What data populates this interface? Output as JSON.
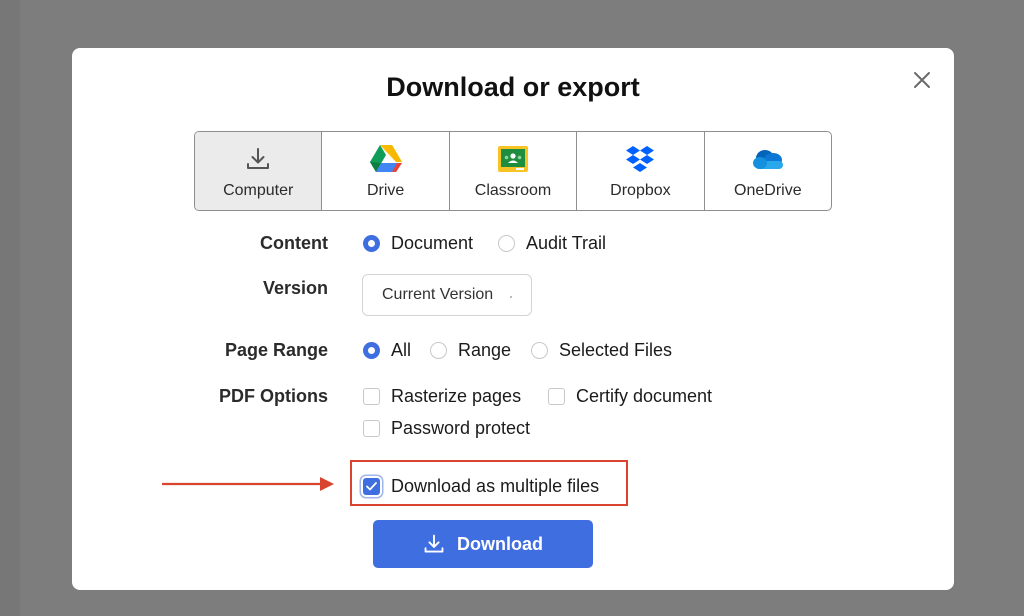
{
  "dialog": {
    "title": "Download or export"
  },
  "destinations": [
    {
      "label": "Computer",
      "icon": "download-icon",
      "active": true
    },
    {
      "label": "Drive",
      "icon": "google-drive-icon",
      "active": false
    },
    {
      "label": "Classroom",
      "icon": "google-classroom-icon",
      "active": false
    },
    {
      "label": "Dropbox",
      "icon": "dropbox-icon",
      "active": false
    },
    {
      "label": "OneDrive",
      "icon": "onedrive-icon",
      "active": false
    }
  ],
  "content": {
    "label": "Content",
    "options": [
      {
        "label": "Document",
        "selected": true
      },
      {
        "label": "Audit Trail",
        "selected": false
      }
    ]
  },
  "version": {
    "label": "Version",
    "value": "Current Version"
  },
  "page_range": {
    "label": "Page Range",
    "options": [
      {
        "label": "All",
        "selected": true
      },
      {
        "label": "Range",
        "selected": false
      },
      {
        "label": "Selected Files",
        "selected": false
      }
    ]
  },
  "pdf_options": {
    "label": "PDF Options",
    "options": [
      {
        "label": "Rasterize pages",
        "checked": false
      },
      {
        "label": "Certify document",
        "checked": false
      },
      {
        "label": "Password protect",
        "checked": false
      }
    ]
  },
  "multiple_files": {
    "label": "Download as multiple files",
    "checked": true
  },
  "download_button": {
    "label": "Download"
  },
  "colors": {
    "accent": "#3f6ee0",
    "annotation": "#d9442e"
  }
}
